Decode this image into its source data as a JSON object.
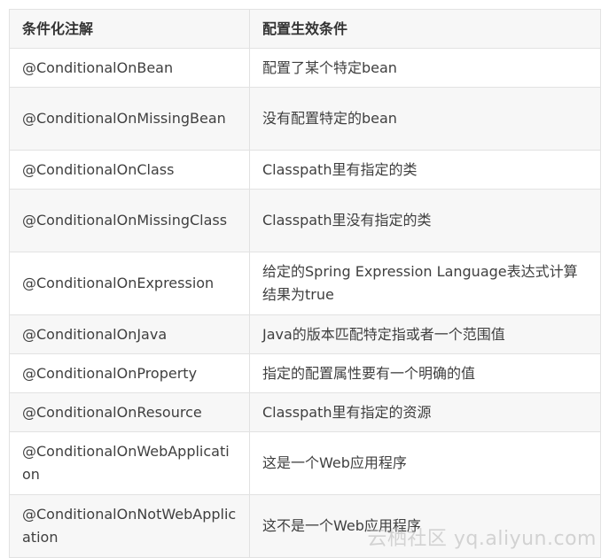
{
  "table": {
    "headers": [
      "条件化注解",
      "配置生效条件"
    ],
    "rows": [
      [
        "@ConditionalOnBean",
        "配置了某个特定bean"
      ],
      [
        "@ConditionalOnMissingBean",
        "没有配置特定的bean"
      ],
      [
        "@ConditionalOnClass",
        "Classpath里有指定的类"
      ],
      [
        "@ConditionalOnMissingClass",
        "Classpath里没有指定的类"
      ],
      [
        "@ConditionalOnExpression",
        "给定的Spring Expression Language表达式计算结果为true"
      ],
      [
        "@ConditionalOnJava",
        "Java的版本匹配特定指或者一个范围值"
      ],
      [
        "@ConditionalOnProperty",
        "指定的配置属性要有一个明确的值"
      ],
      [
        "@ConditionalOnResource",
        "Classpath里有指定的资源"
      ],
      [
        "@ConditionalOnWebApplication",
        "这是一个Web应用程序"
      ],
      [
        "@ConditionalOnNotWebApplication",
        "这不是一个Web应用程序"
      ]
    ]
  },
  "watermark": "云栖社区 yq.aliyun.com"
}
